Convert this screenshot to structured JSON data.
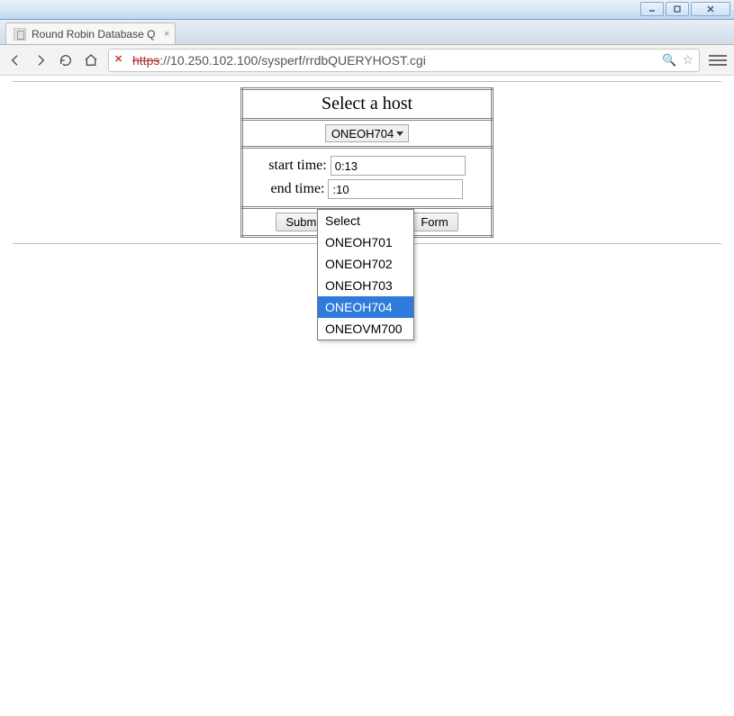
{
  "window": {
    "tab_title": "Round Robin Database Q"
  },
  "omnibox": {
    "protocol": "https",
    "rest": "://10.250.102.100/sysperf/rrdbQUERYHOST.cgi"
  },
  "form": {
    "title": "Select a host",
    "selected_host": "ONEOH704",
    "start_label": "start time:",
    "end_label": "end time:",
    "start_value": "0:13",
    "end_value": ":10",
    "submit_label": "Subm",
    "reset_label": "Form"
  },
  "dropdown": {
    "options": [
      {
        "label": "Select"
      },
      {
        "label": "ONEOH701"
      },
      {
        "label": "ONEOH702"
      },
      {
        "label": "ONEOH703"
      },
      {
        "label": "ONEOH704",
        "selected": true
      },
      {
        "label": "ONEOVM700"
      }
    ]
  }
}
